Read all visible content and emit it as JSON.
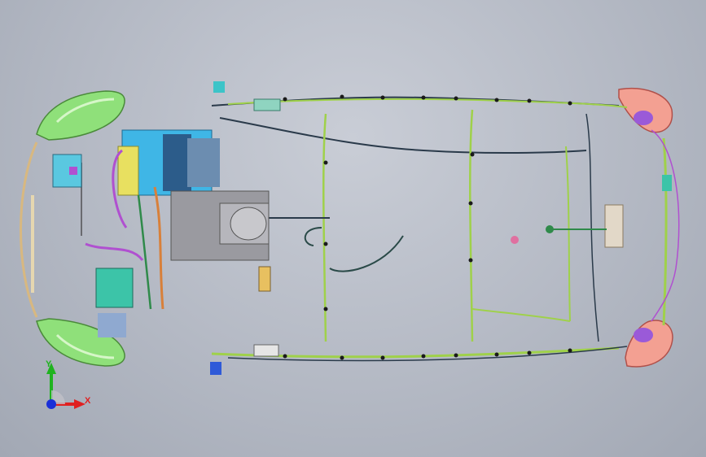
{
  "viewport": {
    "axes": {
      "x_label": "X",
      "y_label": "Y",
      "x_color": "#e02020",
      "y_color": "#1fb31f",
      "z_color": "#1a2fd8"
    },
    "palette": {
      "background": "#b4b9c4",
      "headlamp": "#8fe07a",
      "taillamp": "#f3a092",
      "harness_main": "#9fd14a",
      "harness_dark": "#2a3a4a",
      "harness_purple": "#b050d0",
      "harness_orange": "#d8803a",
      "engine_blue": "#3fb6e6",
      "engine_gray": "#9a9aa0",
      "connector_teal": "#3cc4a8"
    }
  }
}
